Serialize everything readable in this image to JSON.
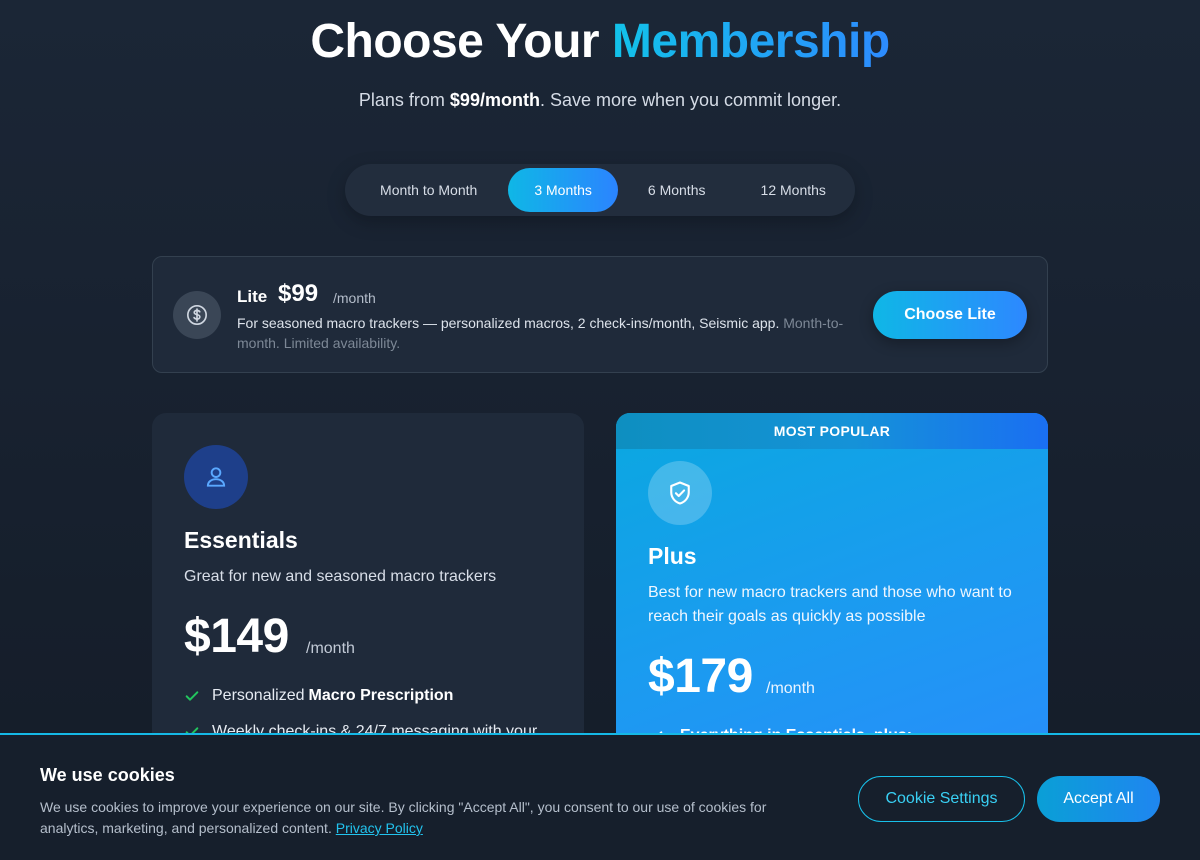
{
  "header": {
    "title_part1": "Choose Your ",
    "title_accent": "Membership",
    "subtitle_prefix": "Plans from ",
    "subtitle_price": "$99/month",
    "subtitle_suffix": ". Save more when you commit longer."
  },
  "billing_toggle": {
    "options": [
      "Month to Month",
      "3 Months",
      "6 Months",
      "12 Months"
    ],
    "selected": "3 Months"
  },
  "lite": {
    "icon": "dollar-coin-icon",
    "name": "Lite",
    "price": "$99",
    "per": "/month",
    "description": "For seasoned macro trackers — personalized macros, 2 check-ins/month, Seismic app.",
    "note": "Month-to-month. Limited availability.",
    "button_label": "Choose Lite"
  },
  "plans": [
    {
      "icon": "user-icon",
      "name": "Essentials",
      "description": "Great for new and seasoned macro trackers",
      "price": "$149",
      "per": "/month",
      "features": [
        {
          "prefix": "Personalized",
          "bold": "Macro Prescription"
        },
        {
          "prefix": "Weekly check-ins & 24/7 messaging with your",
          "bold": ""
        }
      ]
    },
    {
      "badge": "MOST POPULAR",
      "icon": "shield-check-icon",
      "name": "Plus",
      "description": "Best for new macro trackers and those who want to reach their goals as quickly as possible",
      "price": "$179",
      "per": "/month",
      "features": [
        {
          "prefix": "",
          "bold": "Everything in Essentials, plus:"
        }
      ]
    }
  ],
  "cookie_banner": {
    "title": "We use cookies",
    "text": "We use cookies to improve your experience on our site. By clicking \"Accept All\", you consent to our use of cookies for analytics, marketing, and personalized content.",
    "link_label": "Privacy Policy",
    "settings_label": "Cookie Settings",
    "accept_label": "Accept All"
  },
  "colors": {
    "accent_start": "#12c2e9",
    "accent_end": "#2d8bff",
    "check_green": "#22c55e",
    "background": "#1b2636"
  }
}
